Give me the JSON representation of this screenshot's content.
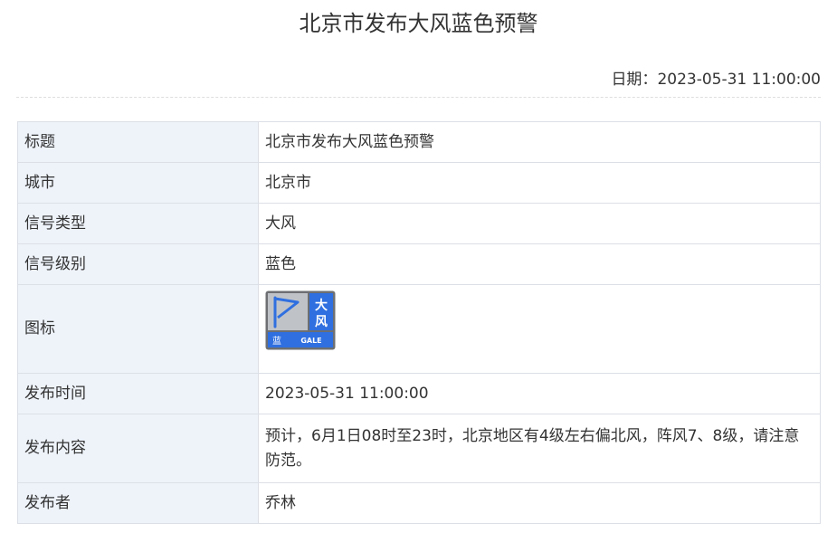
{
  "page": {
    "title": "北京市发布大风蓝色预警",
    "date_label": "日期：",
    "date_value": "2023-05-31 11:00:00"
  },
  "table": {
    "rows": [
      {
        "label": "标题",
        "value": "北京市发布大风蓝色预警"
      },
      {
        "label": "城市",
        "value": "北京市"
      },
      {
        "label": "信号类型",
        "value": "大风"
      },
      {
        "label": "信号级别",
        "value": "蓝色"
      },
      {
        "label": "图标",
        "value": ""
      },
      {
        "label": "发布时间",
        "value": "2023-05-31 11:00:00"
      },
      {
        "label": "发布内容",
        "value": "预计，6月1日08时至23时，北京地区有4级左右偏北风，阵风7、8级，请注意防范。"
      },
      {
        "label": "发布者",
        "value": "乔林"
      }
    ]
  },
  "icon": {
    "name": "gale-blue-warning-icon",
    "text_main": "大风",
    "text_level": "蓝",
    "text_en": "GALE",
    "colors": {
      "frame": "#6d6f72",
      "blue": "#2f6fe0",
      "flag_panel": "#bfc3c8",
      "flag": "#2f6fe0",
      "text": "#ffffff"
    }
  }
}
